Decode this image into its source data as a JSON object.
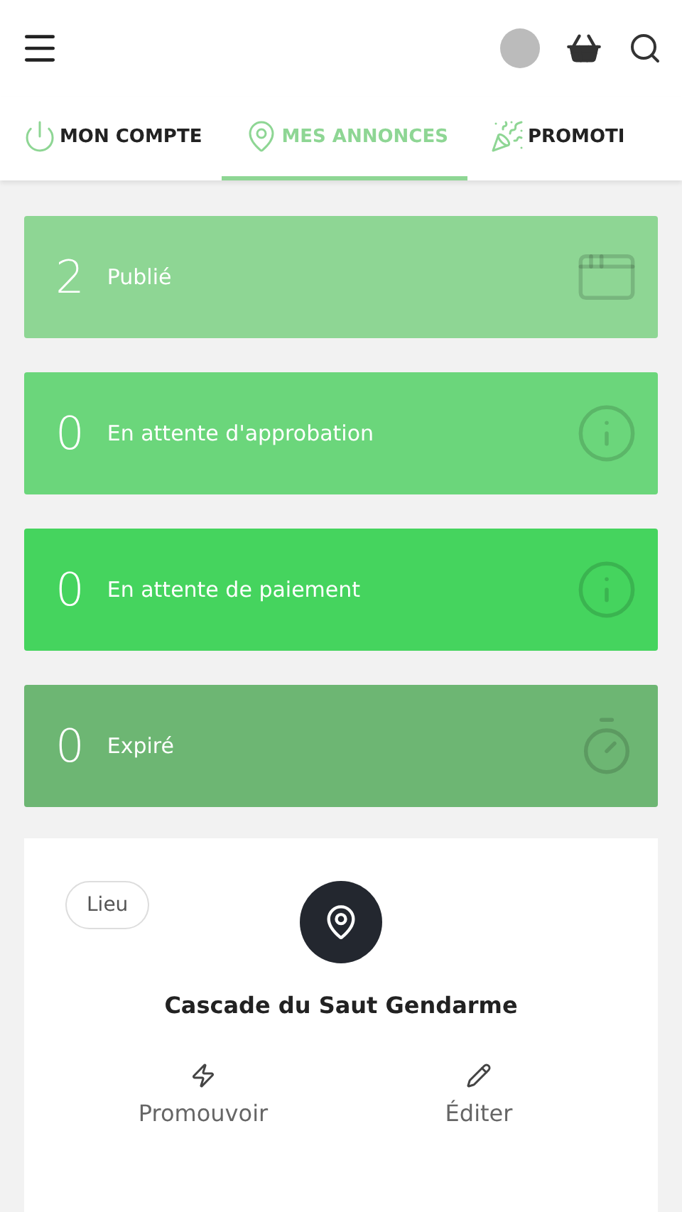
{
  "tabs": [
    {
      "label": "MON COMPTE",
      "selected": false
    },
    {
      "label": "MES ANNONCES",
      "selected": true
    },
    {
      "label": "PROMOTI",
      "selected": false
    }
  ],
  "stats": [
    {
      "count": "2",
      "label": "Publié",
      "color": "#8ed694"
    },
    {
      "count": "0",
      "label": "En attente d'approbation",
      "color": "#6bd67b"
    },
    {
      "count": "0",
      "label": "En attente de paiement",
      "color": "#45d45e"
    },
    {
      "count": "0",
      "label": "Expiré",
      "color": "#6db673"
    }
  ],
  "listing": {
    "tag": "Lieu",
    "title": "Cascade du Saut Gendarme",
    "actions": [
      {
        "label": "Promouvoir"
      },
      {
        "label": "Éditer"
      }
    ]
  }
}
